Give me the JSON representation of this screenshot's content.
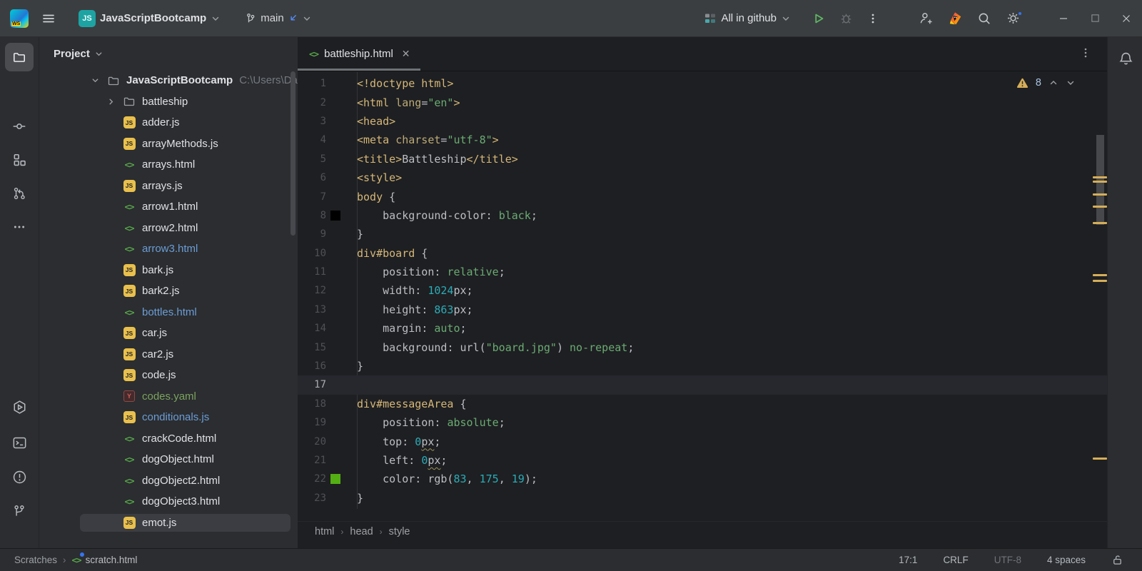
{
  "titlebar": {
    "logo": "WS",
    "project": {
      "badge": "JS",
      "name": "JavaScriptBootcamp"
    },
    "branch": {
      "name": "main"
    },
    "run_widget": {
      "config": "All in github"
    }
  },
  "project_panel": {
    "header": "Project",
    "tree": [
      {
        "name": "JavaScriptBootcamp",
        "icon": "folder",
        "chev": "down",
        "bold": true,
        "path": "C:\\Users\\David",
        "indent": 0
      },
      {
        "name": "battleship",
        "icon": "folder",
        "chev": "right",
        "indent": 1
      },
      {
        "name": "adder.js",
        "icon": "js",
        "indent": 1
      },
      {
        "name": "arrayMethods.js",
        "icon": "js",
        "indent": 1
      },
      {
        "name": "arrays.html",
        "icon": "html",
        "indent": 1
      },
      {
        "name": "arrays.js",
        "icon": "js",
        "indent": 1
      },
      {
        "name": "arrow1.html",
        "icon": "html",
        "indent": 1
      },
      {
        "name": "arrow2.html",
        "icon": "html",
        "indent": 1
      },
      {
        "name": "arrow3.html",
        "icon": "html",
        "state": "modified",
        "indent": 1
      },
      {
        "name": "bark.js",
        "icon": "js",
        "indent": 1
      },
      {
        "name": "bark2.js",
        "icon": "js",
        "indent": 1
      },
      {
        "name": "bottles.html",
        "icon": "html",
        "state": "modified",
        "indent": 1
      },
      {
        "name": "car.js",
        "icon": "js",
        "indent": 1
      },
      {
        "name": "car2.js",
        "icon": "js",
        "indent": 1
      },
      {
        "name": "code.js",
        "icon": "js",
        "indent": 1
      },
      {
        "name": "codes.yaml",
        "icon": "yaml",
        "state": "added",
        "indent": 1
      },
      {
        "name": "conditionals.js",
        "icon": "js",
        "state": "modified",
        "indent": 1
      },
      {
        "name": "crackCode.html",
        "icon": "html",
        "indent": 1
      },
      {
        "name": "dogObject.html",
        "icon": "html",
        "indent": 1
      },
      {
        "name": "dogObject2.html",
        "icon": "html",
        "indent": 1
      },
      {
        "name": "dogObject3.html",
        "icon": "html",
        "indent": 1
      },
      {
        "name": "emot.js",
        "icon": "js",
        "selected": true,
        "indent": 1
      }
    ]
  },
  "editor": {
    "tab": {
      "label": "battleship.html"
    },
    "inspections": {
      "warnings": "8"
    },
    "breadcrumbs": [
      "html",
      "head",
      "style"
    ],
    "scroll_marks_y": [
      195,
      201,
      219,
      236,
      259,
      332,
      340,
      589
    ],
    "code": [
      {
        "n": "1",
        "tokens": [
          [
            "tag",
            "<!doctype html>"
          ]
        ]
      },
      {
        "n": "2",
        "tokens": [
          [
            "tag",
            "<html "
          ],
          [
            "attr",
            "lang"
          ],
          [
            "plain",
            "="
          ],
          [
            "str",
            "\"en\""
          ],
          [
            "tag",
            ">"
          ]
        ]
      },
      {
        "n": "3",
        "tokens": [
          [
            "tag",
            "<head>"
          ]
        ]
      },
      {
        "n": "4",
        "tokens": [
          [
            "tag",
            "<meta "
          ],
          [
            "attr",
            "charset"
          ],
          [
            "plain",
            "="
          ],
          [
            "str",
            "\"utf-8\""
          ],
          [
            "tag",
            ">"
          ]
        ]
      },
      {
        "n": "5",
        "tokens": [
          [
            "tag",
            "<title>"
          ],
          [
            "plain",
            "Battleship"
          ],
          [
            "tag",
            "</title>"
          ]
        ]
      },
      {
        "n": "6",
        "tokens": [
          [
            "tag",
            "<style>"
          ]
        ]
      },
      {
        "n": "7",
        "tokens": [
          [
            "sel",
            "body"
          ],
          [
            "plain",
            " {"
          ]
        ]
      },
      {
        "n": "8",
        "swatch": "#000000",
        "tokens": [
          [
            "plain",
            "    "
          ],
          [
            "prop",
            "background-color"
          ],
          [
            "plain",
            ": "
          ],
          [
            "val",
            "black"
          ],
          [
            "plain",
            ";"
          ]
        ]
      },
      {
        "n": "9",
        "tokens": [
          [
            "plain",
            "}"
          ]
        ]
      },
      {
        "n": "10",
        "tokens": [
          [
            "sel",
            "div"
          ],
          [
            "selid",
            "#board"
          ],
          [
            "plain",
            " {"
          ]
        ]
      },
      {
        "n": "11",
        "tokens": [
          [
            "plain",
            "    "
          ],
          [
            "prop",
            "position"
          ],
          [
            "plain",
            ": "
          ],
          [
            "val",
            "relative"
          ],
          [
            "plain",
            ";"
          ]
        ]
      },
      {
        "n": "12",
        "tokens": [
          [
            "plain",
            "    "
          ],
          [
            "prop",
            "width"
          ],
          [
            "plain",
            ": "
          ],
          [
            "num",
            "1024"
          ],
          [
            "plain",
            "px;"
          ]
        ]
      },
      {
        "n": "13",
        "tokens": [
          [
            "plain",
            "    "
          ],
          [
            "prop",
            "height"
          ],
          [
            "plain",
            ": "
          ],
          [
            "num",
            "863"
          ],
          [
            "plain",
            "px;"
          ]
        ]
      },
      {
        "n": "14",
        "tokens": [
          [
            "plain",
            "    "
          ],
          [
            "prop",
            "margin"
          ],
          [
            "plain",
            ": "
          ],
          [
            "val",
            "auto"
          ],
          [
            "plain",
            ";"
          ]
        ]
      },
      {
        "n": "15",
        "tokens": [
          [
            "plain",
            "    "
          ],
          [
            "prop",
            "background"
          ],
          [
            "plain",
            ": url("
          ],
          [
            "str",
            "\"board.jpg\""
          ],
          [
            "plain",
            ") "
          ],
          [
            "val",
            "no-repeat"
          ],
          [
            "plain",
            ";"
          ]
        ]
      },
      {
        "n": "16",
        "tokens": [
          [
            "plain",
            "}"
          ]
        ]
      },
      {
        "n": "17",
        "current": true,
        "tokens": []
      },
      {
        "n": "18",
        "tokens": [
          [
            "sel",
            "div"
          ],
          [
            "selid",
            "#messageArea"
          ],
          [
            "plain",
            " {"
          ]
        ]
      },
      {
        "n": "19",
        "tokens": [
          [
            "plain",
            "    "
          ],
          [
            "prop",
            "position"
          ],
          [
            "plain",
            ": "
          ],
          [
            "val",
            "absolute"
          ],
          [
            "plain",
            ";"
          ]
        ]
      },
      {
        "n": "20",
        "tokens": [
          [
            "plain",
            "    "
          ],
          [
            "prop",
            "top"
          ],
          [
            "plain",
            ": "
          ],
          [
            "num",
            "0"
          ],
          [
            "wavy",
            "px"
          ],
          [
            "plain",
            ";"
          ]
        ]
      },
      {
        "n": "21",
        "tokens": [
          [
            "plain",
            "    "
          ],
          [
            "prop",
            "left"
          ],
          [
            "plain",
            ": "
          ],
          [
            "num",
            "0"
          ],
          [
            "wavy",
            "px"
          ],
          [
            "plain",
            ";"
          ]
        ]
      },
      {
        "n": "22",
        "swatch": "#53af13",
        "tokens": [
          [
            "plain",
            "    "
          ],
          [
            "prop",
            "color"
          ],
          [
            "plain",
            ": rgb("
          ],
          [
            "num",
            "83"
          ],
          [
            "plain",
            ", "
          ],
          [
            "num",
            "175"
          ],
          [
            "plain",
            ", "
          ],
          [
            "num",
            "19"
          ],
          [
            "plain",
            ");"
          ]
        ]
      },
      {
        "n": "23",
        "tokens": [
          [
            "plain",
            "}"
          ]
        ]
      }
    ]
  },
  "statusbar": {
    "left": [
      "Scratches",
      "scratch.html"
    ],
    "caret": "17:1",
    "line_ending": "CRLF",
    "encoding": "UTF-8",
    "indent": "4 spaces"
  },
  "colors": {
    "accent_blue": "#3574f0",
    "warning_yellow": "#d6ae58",
    "run_green": "#5fb865",
    "swatch_line8": "#000000",
    "swatch_line22": "#53af13"
  }
}
